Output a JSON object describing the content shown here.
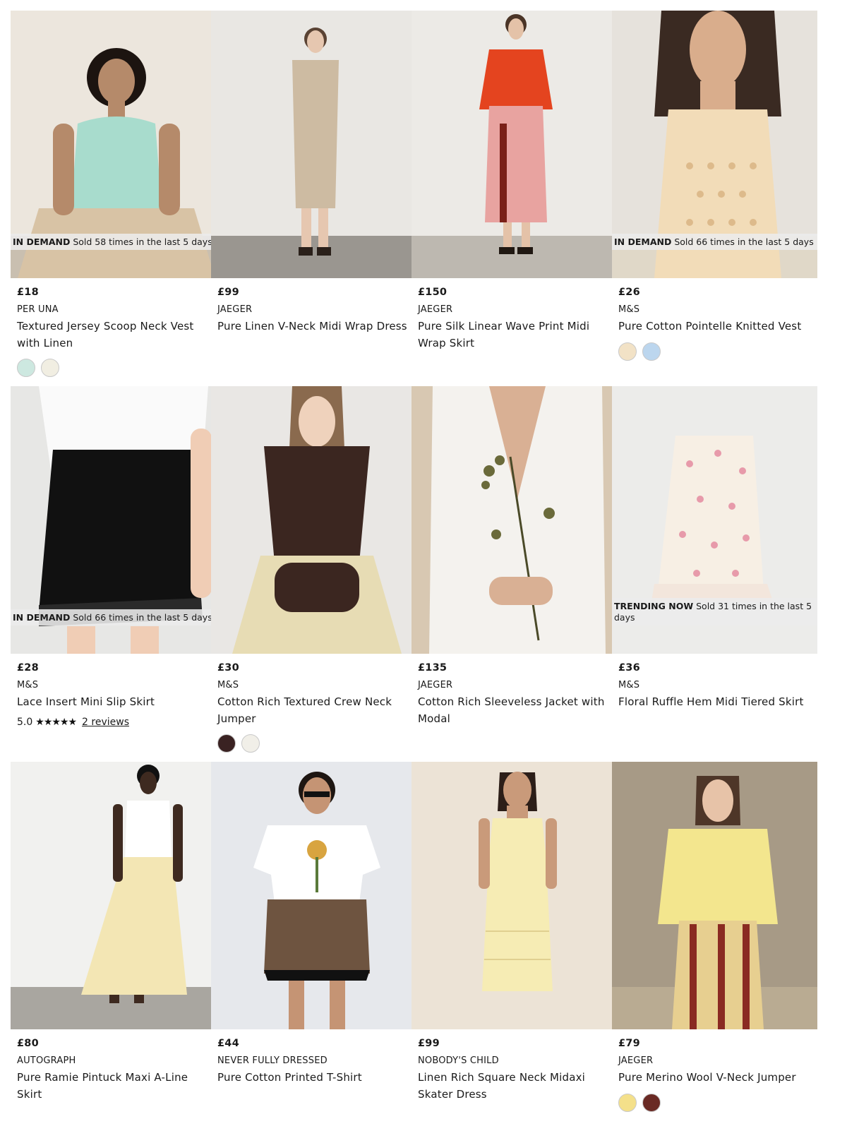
{
  "products": [
    {
      "badge_strong": "IN DEMAND",
      "badge_text": "Sold 58 times in the last 5 days",
      "price": "£18",
      "brand": "PER UNA",
      "name": "Textured Jersey Scoop Neck Vest with Linen",
      "swatches": [
        "#cde8e0",
        "#f1eee2"
      ]
    },
    {
      "badge_strong": "",
      "badge_text": "",
      "price": "£99",
      "brand": "JAEGER",
      "name": "Pure Linen V-Neck Midi Wrap Dress",
      "swatches": []
    },
    {
      "badge_strong": "",
      "badge_text": "",
      "price": "£150",
      "brand": "JAEGER",
      "name": "Pure Silk Linear Wave Print Midi Wrap Skirt",
      "swatches": []
    },
    {
      "badge_strong": "IN DEMAND",
      "badge_text": "Sold 66 times in the last 5 days",
      "price": "£26",
      "brand": "M&S",
      "name": "Pure Cotton Pointelle Knitted Vest",
      "swatches": [
        "#f2e2c6",
        "#bcd6ee"
      ]
    },
    {
      "badge_strong": "IN DEMAND",
      "badge_text": "Sold 66 times in the last 5 days",
      "price": "£28",
      "brand": "M&S",
      "name": "Lace Insert Mini Slip Skirt",
      "swatches": [],
      "rating": "5.0",
      "stars": "★★★★★",
      "reviews": "2 reviews"
    },
    {
      "badge_strong": "",
      "badge_text": "",
      "price": "£30",
      "brand": "M&S",
      "name": "Cotton Rich Textured Crew Neck Jumper",
      "swatches": [
        "#3a2222",
        "#f1efe8"
      ]
    },
    {
      "badge_strong": "",
      "badge_text": "",
      "price": "£135",
      "brand": "JAEGER",
      "name": "Cotton Rich Sleeveless Jacket with Modal",
      "swatches": []
    },
    {
      "badge_strong": "TRENDING NOW",
      "badge_text": "Sold 31 times in the last 5 days",
      "price": "£36",
      "brand": "M&S",
      "name": "Floral Ruffle Hem Midi Tiered Skirt",
      "swatches": []
    },
    {
      "badge_strong": "",
      "badge_text": "",
      "price": "£80",
      "brand": "AUTOGRAPH",
      "name": "Pure Ramie Pintuck Maxi A-Line Skirt",
      "swatches": []
    },
    {
      "badge_strong": "",
      "badge_text": "",
      "price": "£44",
      "brand": "NEVER FULLY DRESSED",
      "name": "Pure Cotton Printed T-Shirt",
      "swatches": []
    },
    {
      "badge_strong": "",
      "badge_text": "",
      "price": "£99",
      "brand": "NOBODY'S CHILD",
      "name": "Linen Rich Square Neck Midaxi Skater Dress",
      "swatches": []
    },
    {
      "badge_strong": "",
      "badge_text": "",
      "price": "£79",
      "brand": "JAEGER",
      "name": "Pure Merino Wool V-Neck Jumper",
      "swatches": [
        "#f4e08a",
        "#6a2a24"
      ]
    }
  ],
  "images": [
    {
      "bg": "#ece6dd",
      "floor": "#c9bfb0",
      "top": "#a8dccd",
      "bottom": "#d8c3a5",
      "skin": "#b58a6a",
      "hair": "#1c1410"
    },
    {
      "bg": "#e9e7e3",
      "floor": "#9a9690",
      "top": "#cdbba2",
      "bottom": "#cdbba2",
      "skin": "#e6c7b0",
      "hair": "#5a4334"
    },
    {
      "bg": "#eceae6",
      "floor": "#bdb8b0",
      "top": "#e4441f",
      "bottom": "#e8a3a0",
      "skin": "#e4c2a8",
      "hair": "#4a3426"
    },
    {
      "bg": "#e6e2dc",
      "floor": "#e0d8c8",
      "top": "#f2dcb8",
      "bottom": "#f2dcb8",
      "skin": "#d9ad8c",
      "hair": "#3a2a22"
    },
    {
      "bg": "#e7e7e5",
      "floor": "#e7e7e5",
      "top": "#fafafa",
      "bottom": "#111111",
      "skin": "#f0cdb5",
      "hair": "#e7e7e5"
    },
    {
      "bg": "#e9e7e4",
      "floor": "#e9e7e4",
      "top": "#3b2620",
      "bottom": "#e7dcb4",
      "skin": "#efd2bc",
      "hair": "#8a6a4e"
    },
    {
      "bg": "#d8c8b2",
      "floor": "#d8c8b2",
      "top": "#f4f2ee",
      "bottom": "#f4f2ee",
      "skin": "#d9b094",
      "hair": "#d8c8b2"
    },
    {
      "bg": "#ececea",
      "floor": "#ececea",
      "top": "#f7efe4",
      "bottom": "#f7efe4",
      "skin": "#ececea",
      "hair": "#ececea"
    },
    {
      "bg": "#f1f1ef",
      "floor": "#a9a6a0",
      "top": "#ffffff",
      "bottom": "#f3e6b4",
      "skin": "#3e2a20",
      "hair": "#111111"
    },
    {
      "bg": "#e6e8ec",
      "floor": "#e6e8ec",
      "top": "#ffffff",
      "bottom": "#6e5440",
      "skin": "#c59474",
      "hair": "#1e1612"
    },
    {
      "bg": "#ece3d6",
      "floor": "#ece3d6",
      "top": "#f6ecb4",
      "bottom": "#f6ecb4",
      "skin": "#c99a7a",
      "hair": "#2c1e18"
    },
    {
      "bg": "#a79a86",
      "floor": "#b9ab92",
      "top": "#f3e68e",
      "bottom": "#e7cf90",
      "skin": "#e7c3a8",
      "hair": "#4e3628"
    }
  ]
}
